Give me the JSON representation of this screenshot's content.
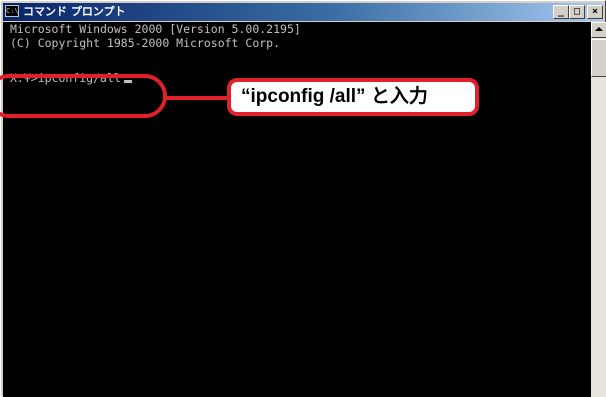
{
  "window": {
    "title": "コマンド プロンプト",
    "icon": "console-icon",
    "controls": {
      "minimize": "_",
      "maximize": "□",
      "close": "×"
    }
  },
  "console": {
    "lines": [
      "Microsoft Windows 2000 [Version 5.00.2195]",
      "(C) Copyright 1985-2000 Microsoft Corp."
    ],
    "prompt": "X:¥>",
    "command": "ipconfig/all"
  },
  "annotation": {
    "callout_text": "“ipconfig /all” と入力",
    "color": "#e0202a"
  },
  "colors": {
    "console_bg": "#000000",
    "console_text": "#c0c0c0",
    "titlebar_start": "#0a246a",
    "titlebar_end": "#a6caf0"
  }
}
